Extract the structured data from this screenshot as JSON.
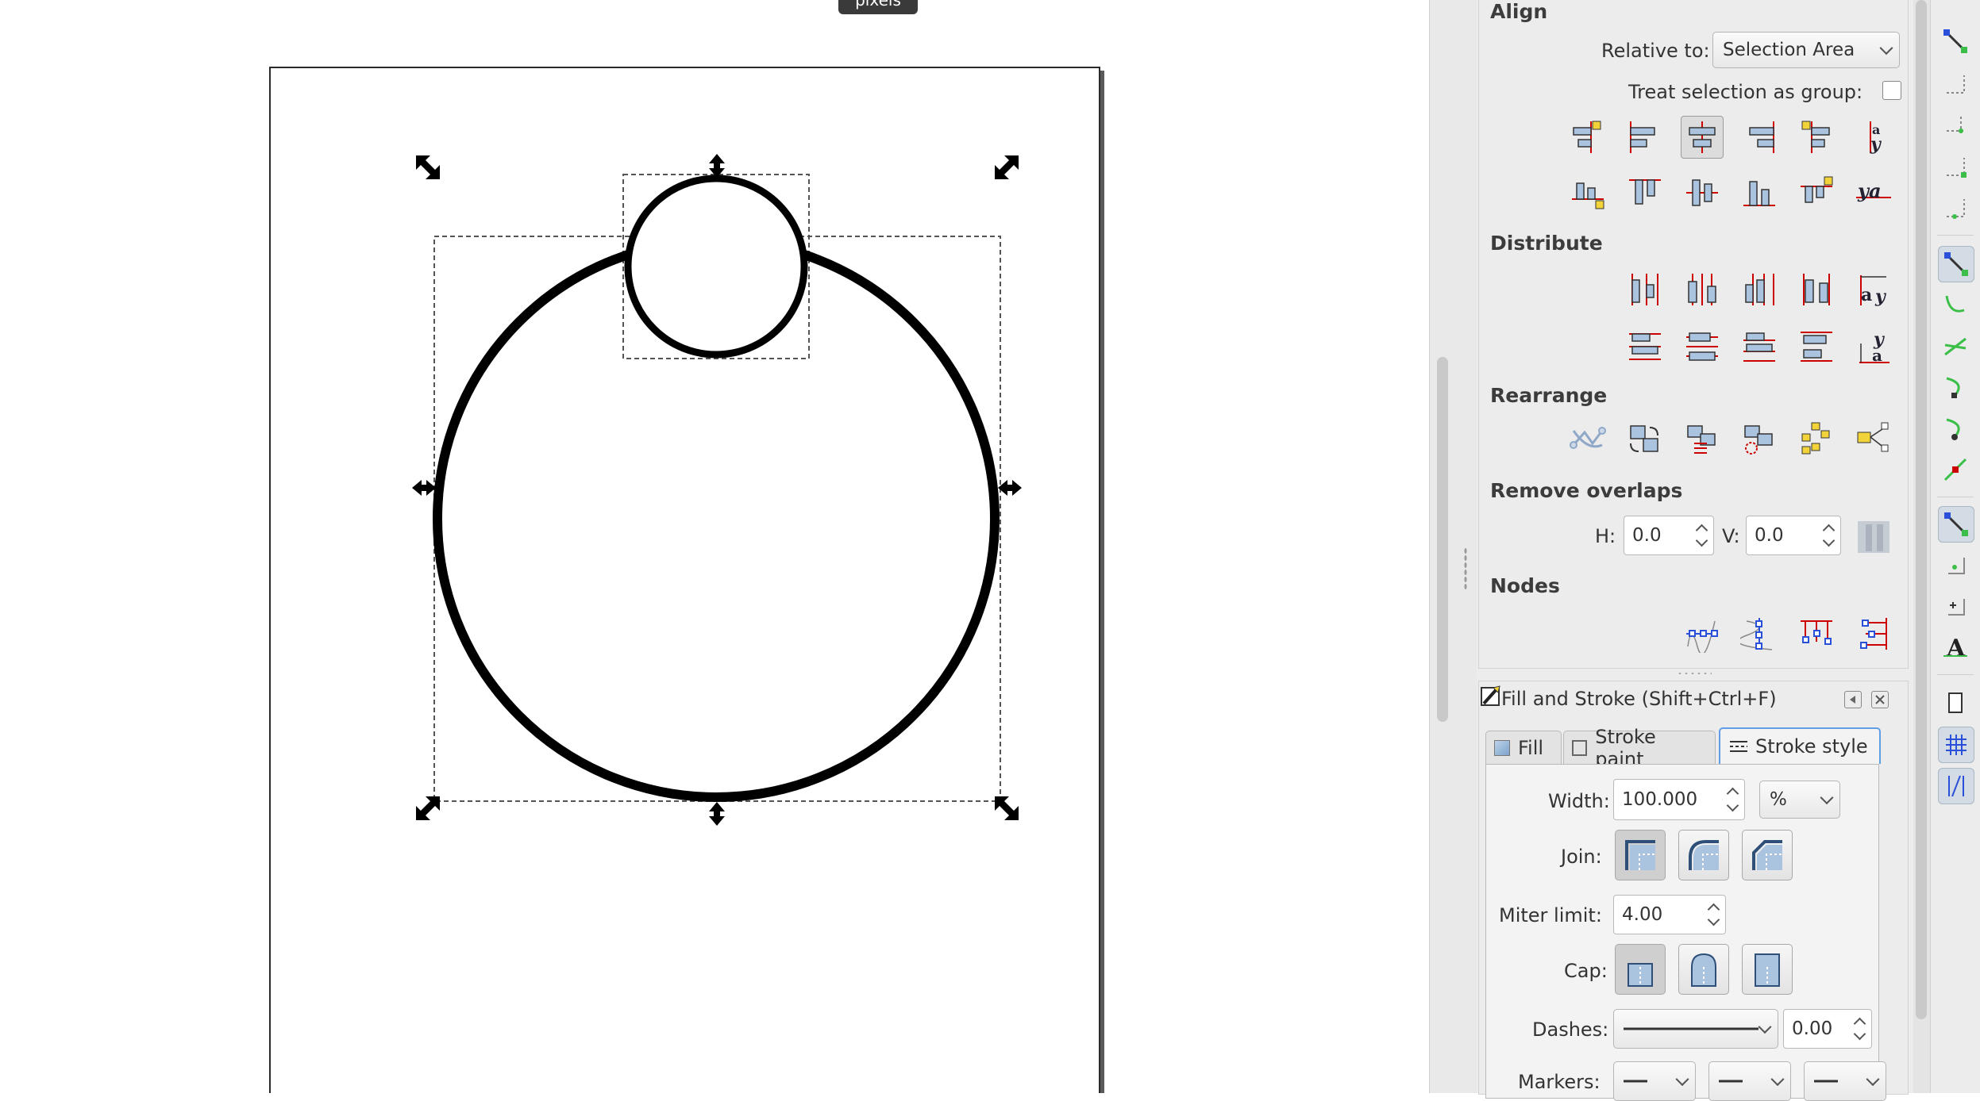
{
  "canvas": {
    "tooltip": "pixels"
  },
  "align_panel": {
    "title": "Align",
    "relative_to_label": "Relative to:",
    "relative_to_value": "Selection Area",
    "treat_as_group_label": "Treat selection as group:",
    "treat_as_group_checked": false,
    "distribute_title": "Distribute",
    "rearrange_title": "Rearrange",
    "remove_overlaps_title": "Remove overlaps",
    "h_label": "H:",
    "h_value": "0.0",
    "v_label": "V:",
    "v_value": "0.0",
    "nodes_title": "Nodes"
  },
  "fill_stroke": {
    "title": "Fill and Stroke (Shift+Ctrl+F)",
    "tabs": [
      "Fill",
      "Stroke paint",
      "Stroke style"
    ],
    "active_tab": "Stroke style",
    "width_label": "Width:",
    "width_value": "100.000",
    "width_unit": "%",
    "join_label": "Join:",
    "miter_label": "Miter limit:",
    "miter_value": "4.00",
    "cap_label": "Cap:",
    "dashes_label": "Dashes:",
    "dashes_offset": "0.00",
    "markers_label": "Markers:"
  },
  "colors": {
    "accent": "#5f9ee6",
    "selection_handle": "#000000",
    "align_icon_red": "#cc0000",
    "align_icon_blue": "#aac4e0",
    "align_icon_yellow": "#f2d43a"
  }
}
